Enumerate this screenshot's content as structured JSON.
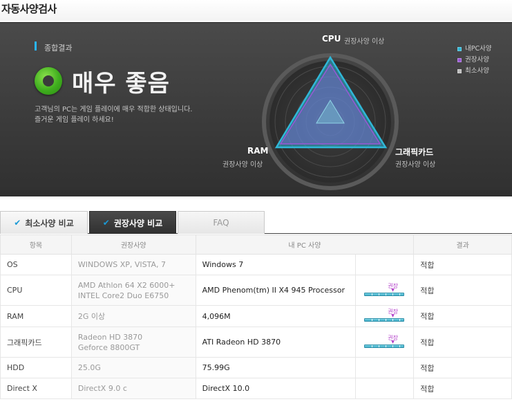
{
  "page": {
    "title": "자동사양검사"
  },
  "summary": {
    "label": "종합결과",
    "grade": "매우 좋음",
    "description_line1": "고객님의 PC는 게임 플레이에 매우 적합한 상태입니다.",
    "description_line2": "즐거운 게임 플레이 하세요!"
  },
  "radar": {
    "axes": [
      {
        "name": "CPU",
        "status": "권장사양 이상"
      },
      {
        "name": "RAM",
        "status": "권장사양 이상"
      },
      {
        "name": "그래픽카드",
        "status": "권장사양 이상"
      }
    ],
    "legend": [
      {
        "label": "내PC사양",
        "color": "#2fb8d8"
      },
      {
        "label": "권장사양",
        "color": "#9a57d6"
      },
      {
        "label": "최소사양",
        "color": "#bdbdbd"
      }
    ]
  },
  "tabs": [
    {
      "label": "최소사양 비교",
      "active": false
    },
    {
      "label": "권장사양 비교",
      "active": true
    },
    {
      "label": "FAQ",
      "active": false
    }
  ],
  "table": {
    "headers": [
      "항목",
      "권장사양",
      "내 PC 사양",
      "",
      "결과"
    ],
    "rows": [
      {
        "item": "OS",
        "rec1": "WINDOWS XP, VISTA, 7",
        "rec2": "",
        "mine": "Windows 7",
        "gauge": false,
        "result": "적합"
      },
      {
        "item": "CPU",
        "rec1": "AMD Athlon 64 X2 6000+",
        "rec2": "INTEL Core2 Duo E6750",
        "mine": "AMD Phenom(tm) II X4 945 Processor",
        "gauge": true,
        "result": "적합"
      },
      {
        "item": "RAM",
        "rec1": "2G 이상",
        "rec2": "",
        "mine": "4,096M",
        "gauge": true,
        "result": "적합"
      },
      {
        "item": "그래픽카드",
        "rec1": "Radeon HD 3870",
        "rec2": "Geforce 8800GT",
        "mine": "ATI Radeon HD 3870",
        "gauge": true,
        "result": "적합"
      },
      {
        "item": "HDD",
        "rec1": "25.0G",
        "rec2": "",
        "mine": "75.99G",
        "gauge": false,
        "result": "적합"
      },
      {
        "item": "Direct X",
        "rec1": "DirectX 9.0 c",
        "rec2": "",
        "mine": "DirectX 10.0",
        "gauge": false,
        "result": "적합"
      }
    ],
    "gauge_label": "권장"
  }
}
